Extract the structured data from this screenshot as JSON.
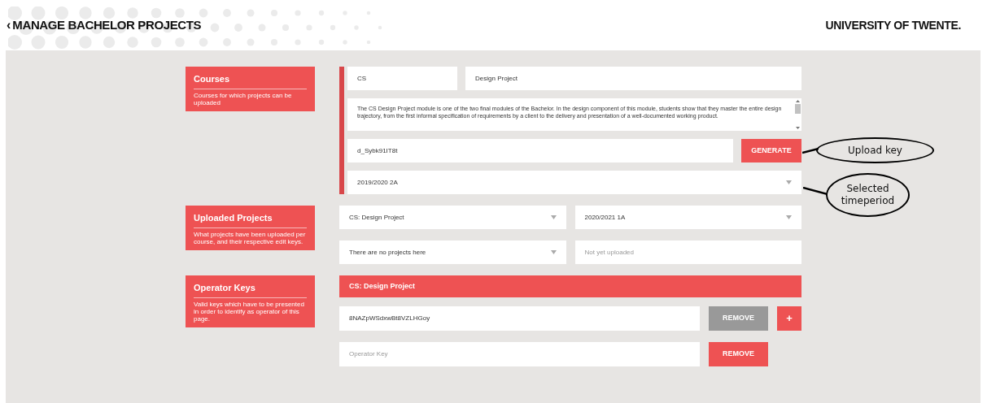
{
  "header": {
    "back_icon": "‹",
    "title": "MANAGE BACHELOR PROJECTS",
    "brand": "UNIVERSITY OF TWENTE."
  },
  "sections": [
    {
      "kind": "courses",
      "title": "Courses",
      "description": "Courses for which projects can be uploaded",
      "code": "CS",
      "name": "Design Project",
      "summary": "The CS Design Project module is one of the two final modules of the Bachelor. In the design component of this module, students show that they master the entire design trajectory, from the first informal specification of requirements by a client to the delivery and presentation of a well-documented working product.",
      "upload_key": "d_Sybk91IT8t",
      "generate_button": "GENERATE",
      "period": "2019/2020 2A"
    },
    {
      "kind": "uploads",
      "title": "Uploaded Projects",
      "description": "What projects have been uploaded per course, and their respective edit keys.",
      "course": "CS: Design Project",
      "period": "2020/2021 1A",
      "project": "There are no projects here",
      "edit_key_placeholder": "Not yet uploaded"
    },
    {
      "kind": "operators",
      "title": "Operator Keys",
      "description": "Valid keys which have to be presented in order to identify as operator of this page.",
      "course": "CS: Design Project",
      "keys": [
        {
          "value": "8NAZpWSdxwBt8VZLHGoy",
          "remove_button": "REMOVE",
          "disabled": true,
          "add_button": "+"
        },
        {
          "placeholder": "Operator Key",
          "remove_button": "REMOVE",
          "disabled": false
        }
      ]
    }
  ],
  "annotations": [
    {
      "text": "Upload key"
    },
    {
      "text": "Selected timeperiod"
    }
  ]
}
